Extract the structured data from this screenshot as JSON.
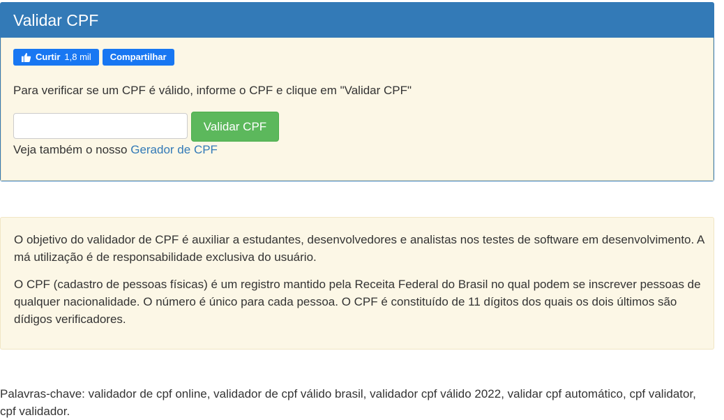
{
  "header": {
    "title": "Validar CPF"
  },
  "social": {
    "like_label": "Curtir",
    "like_count": "1,8 mil",
    "share_label": "Compartilhar"
  },
  "form": {
    "intro": "Para verificar se um CPF é válido, informe o CPF e clique em \"Validar CPF\"",
    "input_value": "",
    "button_label": "Validar CPF",
    "see_also_prefix": "Veja também o nosso ",
    "see_also_link": "Gerador de CPF"
  },
  "info": {
    "paragraph1": "O objetivo do validador de CPF é auxiliar a estudantes, desenvolvedores e analistas nos testes de software em desenvolvimento. A má utilização é de responsabilidade exclusiva do usuário.",
    "paragraph2": "O CPF (cadastro de pessoas físicas) é um registro mantido pela Receita Federal do Brasil no qual podem se inscrever pessoas de qualquer nacionalidade. O número é único para cada pessoa. O CPF é constituído de 11 dígitos dos quais os dois últimos são dídigos verificadores."
  },
  "keywords": "Palavras-chave: validador de cpf online, validador de cpf válido brasil, validador cpf válido 2022, validar cpf automático, cpf validator, cpf validador.",
  "colors": {
    "primary": "#337ab7",
    "success": "#5cb85c",
    "facebook": "#1877f2",
    "panel_bg": "#fcf7e6"
  },
  "icons": {
    "like": "thumbs-up-icon"
  }
}
